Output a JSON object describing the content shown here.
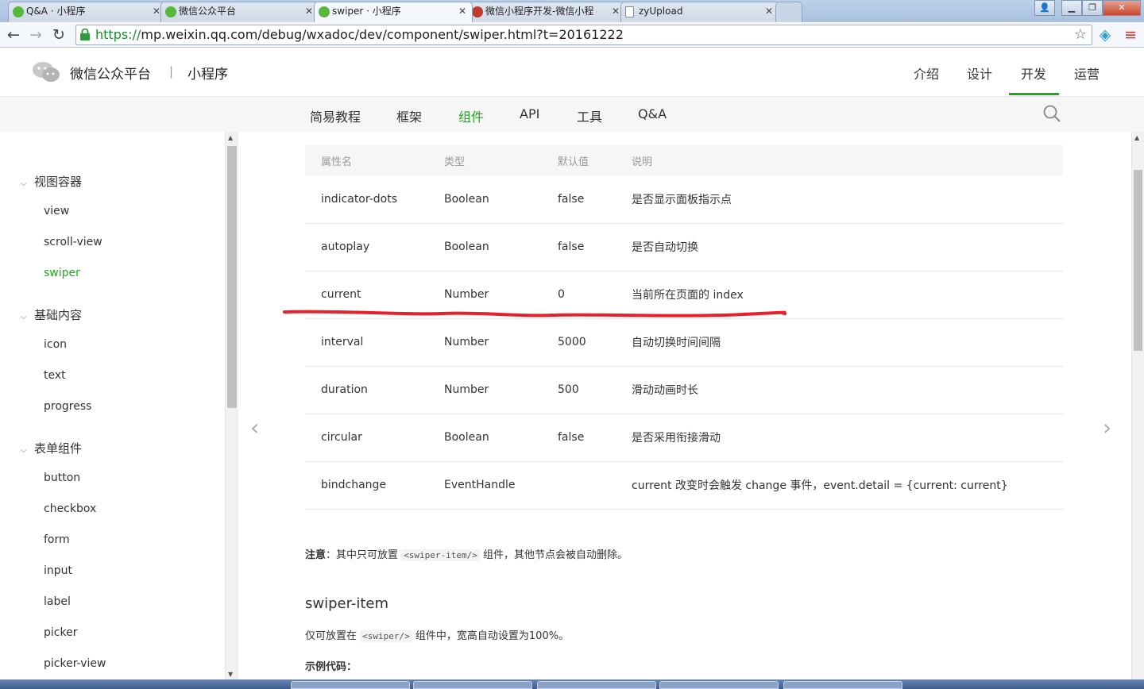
{
  "browser": {
    "tabs": [
      {
        "title": "Q&A · 小程序"
      },
      {
        "title": "微信公众平台"
      },
      {
        "title": "swiper · 小程序"
      },
      {
        "title": "微信小程序开发-微信小程"
      },
      {
        "title": "zyUpload"
      }
    ],
    "url_scheme": "https://",
    "url_rest": "mp.weixin.qq.com/debug/wxadoc/dev/component/swiper.html?t=20161222"
  },
  "header": {
    "brand": "微信公众平台",
    "separator": "|",
    "sub": "小程序",
    "nav": [
      "介绍",
      "设计",
      "开发",
      "运营"
    ],
    "active_nav": "开发"
  },
  "subnav": {
    "items": [
      "简易教程",
      "框架",
      "组件",
      "API",
      "工具",
      "Q&A"
    ],
    "active": "组件"
  },
  "sidebar": {
    "groups": [
      {
        "title": "视图容器",
        "items": [
          "view",
          "scroll-view",
          "swiper"
        ]
      },
      {
        "title": "基础内容",
        "items": [
          "icon",
          "text",
          "progress"
        ]
      },
      {
        "title": "表单组件",
        "items": [
          "button",
          "checkbox",
          "form",
          "input",
          "label",
          "picker",
          "picker-view"
        ]
      }
    ],
    "active_item": "swiper"
  },
  "table": {
    "headers": [
      "属性名",
      "类型",
      "默认值",
      "说明"
    ],
    "rows": [
      [
        "indicator-dots",
        "Boolean",
        "false",
        "是否显示面板指示点"
      ],
      [
        "autoplay",
        "Boolean",
        "false",
        "是否自动切换"
      ],
      [
        "current",
        "Number",
        "0",
        "当前所在页面的 index"
      ],
      [
        "interval",
        "Number",
        "5000",
        "自动切换时间间隔"
      ],
      [
        "duration",
        "Number",
        "500",
        "滑动动画时长"
      ],
      [
        "circular",
        "Boolean",
        "false",
        "是否采用衔接滑动"
      ],
      [
        "bindchange",
        "EventHandle",
        "",
        "current 改变时会触发 change 事件，event.detail = {current: current}"
      ]
    ]
  },
  "note": {
    "label": "注意",
    "colon": "：",
    "text1": "其中只可放置",
    "code": "<swiper-item/>",
    "text2": "组件，其他节点会被自动删除。"
  },
  "section": {
    "title": "swiper-item",
    "text1": "仅可放置在",
    "code": "<swiper/>",
    "text2": "组件中，宽高自动设置为100%。",
    "sample": "示例代码："
  },
  "colors": {
    "accent": "#1aad19",
    "annotation": "#e8202a"
  }
}
